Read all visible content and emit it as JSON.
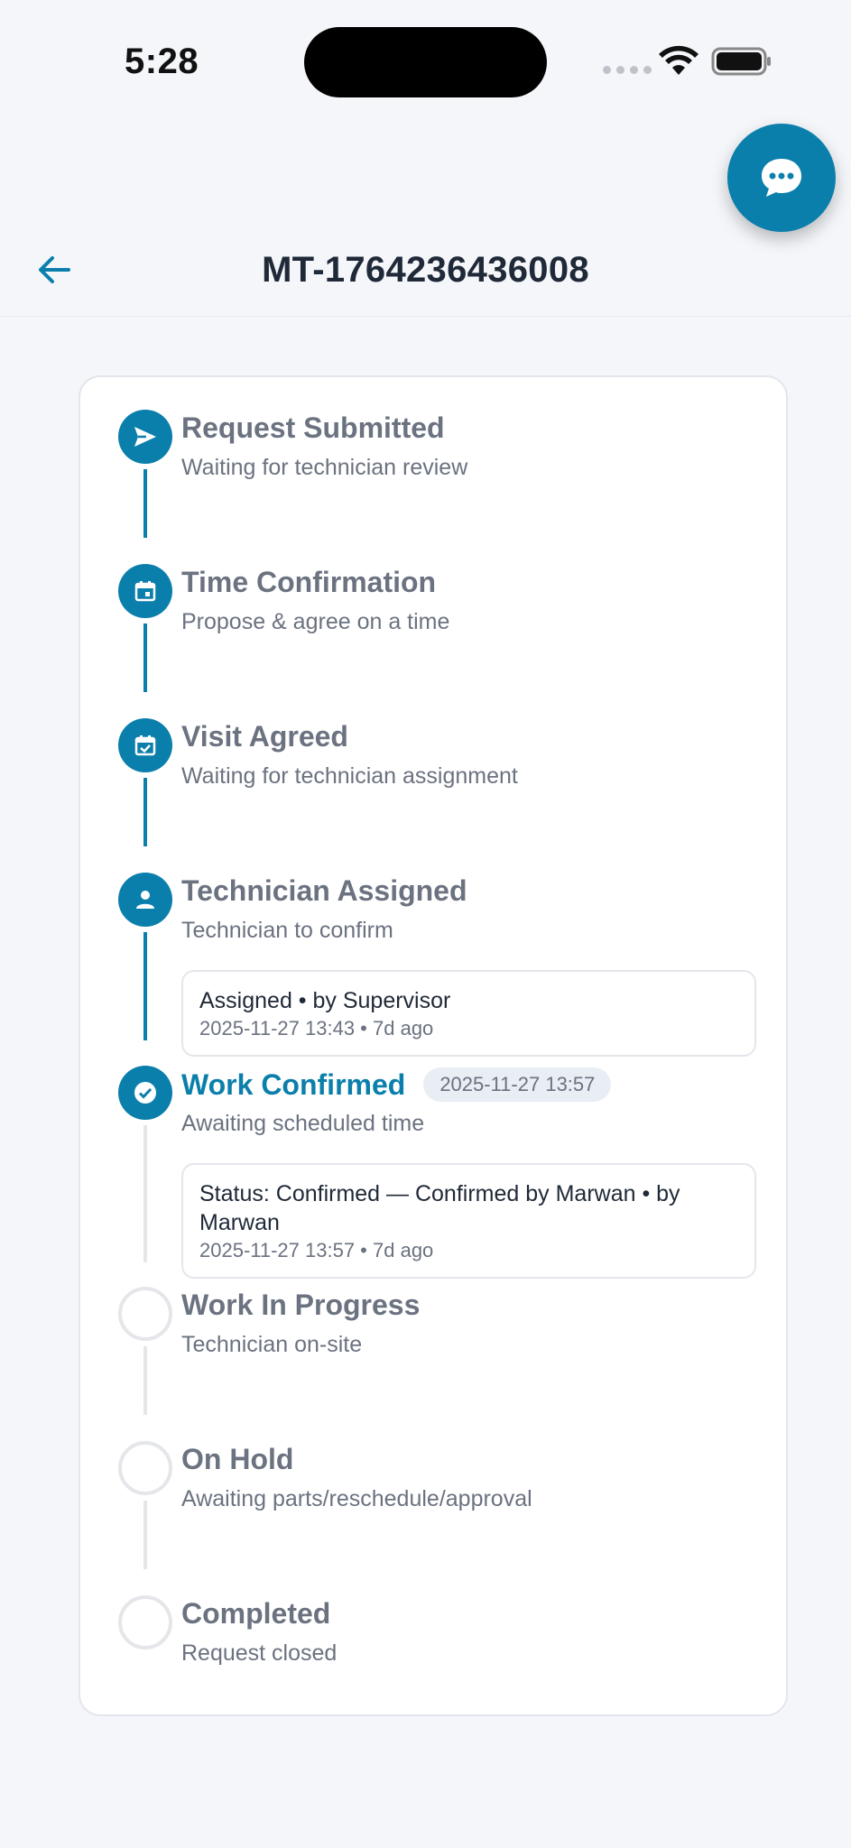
{
  "status_bar": {
    "time": "5:28"
  },
  "header": {
    "title": "MT-1764236436008"
  },
  "steps": [
    {
      "title": "Request Submitted",
      "subtitle": "Waiting for technician review",
      "icon": "send-icon"
    },
    {
      "title": "Time Confirmation",
      "subtitle": "Propose & agree on a time",
      "icon": "calendar-icon"
    },
    {
      "title": "Visit Agreed",
      "subtitle": "Waiting for technician assignment",
      "icon": "calendar-check-icon"
    },
    {
      "title": "Technician Assigned",
      "subtitle": "Technician to confirm",
      "icon": "person-icon",
      "entry": {
        "text": "Assigned • by Supervisor",
        "meta": "2025-11-27 13:43 • 7d ago"
      }
    },
    {
      "title": "Work Confirmed",
      "subtitle": "Awaiting scheduled time",
      "icon": "check-circle-icon",
      "badge": "2025-11-27 13:57",
      "entry": {
        "text": "Status: Confirmed — Confirmed by Marwan • by Marwan",
        "meta": "2025-11-27 13:57 • 7d ago"
      }
    },
    {
      "title": "Work In Progress",
      "subtitle": "Technician on-site"
    },
    {
      "title": "On Hold",
      "subtitle": "Awaiting parts/reschedule/approval"
    },
    {
      "title": "Completed",
      "subtitle": "Request closed"
    }
  ],
  "colors": {
    "accent": "#0b7fab",
    "muted": "#6b7280",
    "pending": "#e4e6ea"
  }
}
